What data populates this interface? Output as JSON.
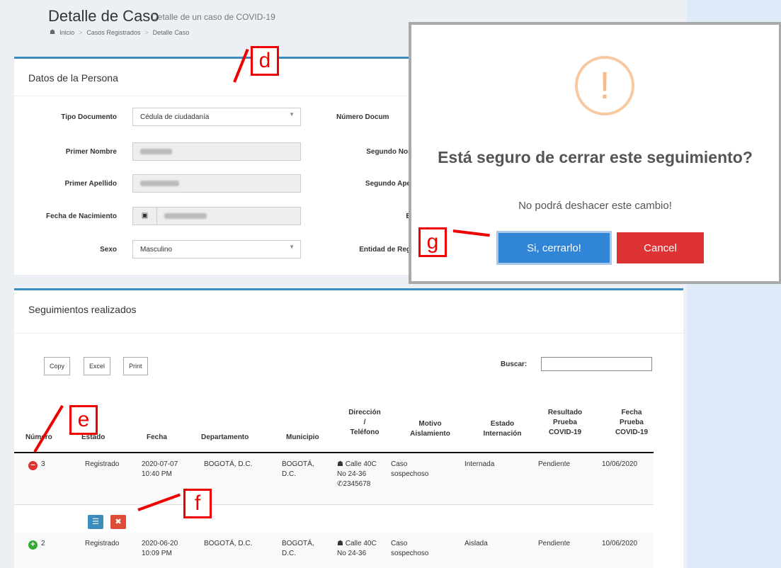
{
  "header": {
    "title": "Detalle de Caso",
    "subtitle": "Detalle de un caso de COVID-19",
    "breadcrumb": [
      "Inicio",
      "Casos Registrados",
      "Detalle Caso"
    ]
  },
  "persona": {
    "title": "Datos de la Persona",
    "fields": {
      "tipo_documento_label": "Tipo Documento",
      "tipo_documento_value": "Cédula de ciudadanía",
      "numero_documento_label": "Número Docum",
      "primer_nombre_label": "Primer Nombre",
      "segundo_nombre_label": "Segundo Nor",
      "primer_apellido_label": "Primer Apellido",
      "segundo_apellido_label": "Segundo Ape",
      "fecha_nacimiento_label": "Fecha de Nacimiento",
      "e_label": "E",
      "sexo_label": "Sexo",
      "sexo_value": "Masculino",
      "entidad_label": "Entidad de Reg"
    }
  },
  "seguimientos": {
    "title": "Seguimientos realizados",
    "buttons": {
      "copy": "Copy",
      "excel": "Excel",
      "print": "Print"
    },
    "search_label": "Buscar:",
    "headers": {
      "numero": "Número",
      "estado": "Estado",
      "fecha": "Fecha",
      "departamento": "Departamento",
      "municipio": "Municipio",
      "direccion_1": "Dirección",
      "direccion_2": "/",
      "direccion_3": "Teléfono",
      "motivo_1": "Motivo",
      "motivo_2": "Aislamiento",
      "internacion_1": "Estado",
      "internacion_2": "Internación",
      "resultado_1": "Resultado",
      "resultado_2": "Prueba",
      "resultado_3": "COVID-19",
      "fprueba_1": "Fecha",
      "fprueba_2": "Prueba",
      "fprueba_3": "COVID-19"
    },
    "rows": [
      {
        "numero": "3",
        "estado": "Registrado",
        "fecha_1": "2020-07-07",
        "fecha_2": "10:40 PM",
        "departamento": "BOGOTÁ, D.C.",
        "municipio_1": "BOGOTÁ,",
        "municipio_2": "D.C.",
        "dir_1": "Calle 40C",
        "dir_2": "No 24-36",
        "telefono": "2345678",
        "motivo_1": "Caso",
        "motivo_2": "sospechoso",
        "internacion": "Internada",
        "resultado": "Pendiente",
        "fecha_prueba": "10/06/2020"
      },
      {
        "numero": "2",
        "estado": "Registrado",
        "fecha_1": "2020-06-20",
        "fecha_2": "10:09 PM",
        "departamento": "BOGOTÁ, D.C.",
        "municipio_1": "BOGOTÁ,",
        "municipio_2": "D.C.",
        "dir_1": "Calle 40C",
        "dir_2": "No 24-36",
        "motivo_1": "Caso",
        "motivo_2": "sospechoso",
        "internacion": "Aislada",
        "resultado": "Pendiente",
        "fecha_prueba": "10/06/2020"
      }
    ]
  },
  "modal": {
    "icon": "!",
    "title": "Está seguro de cerrar este seguimiento?",
    "text": "No podrá deshacer este cambio!",
    "confirm": "Si, cerrarlo!",
    "cancel": "Cancel"
  },
  "annotations": {
    "d": "d",
    "e": "e",
    "f": "f",
    "g": "g"
  },
  "colors": {
    "accent": "#3c8dbc",
    "confirm": "#3085d6",
    "cancel": "#dd3333",
    "warning": "#f8bb86",
    "annotation": "#ee0000"
  }
}
